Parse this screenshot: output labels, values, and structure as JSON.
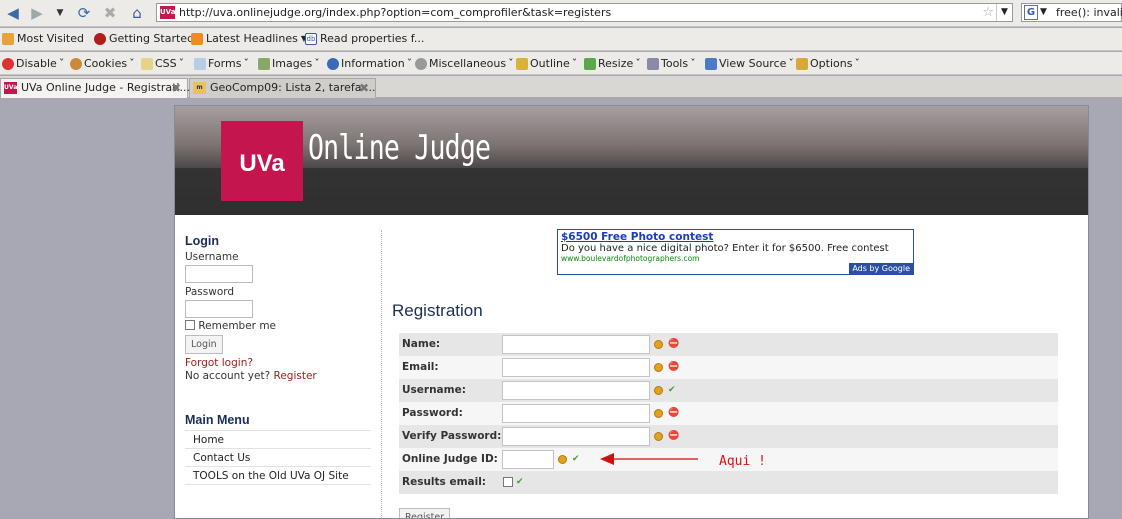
{
  "browser": {
    "url": "http://uva.onlinejudge.org/index.php?option=com_comprofiler&task=registers",
    "search_text": "free(): invalid",
    "bookmarks": [
      "Most Visited",
      "Getting Started",
      "Latest Headlines",
      "Read properties f..."
    ],
    "devtools": [
      "Disable",
      "Cookies",
      "CSS",
      "Forms",
      "Images",
      "Information",
      "Miscellaneous",
      "Outline",
      "Resize",
      "Tools",
      "View Source",
      "Options"
    ],
    "tabs": [
      {
        "title": "UVa Online Judge - Registrati..."
      },
      {
        "title": "GeoComp09: Lista 2, tarefa ..."
      }
    ]
  },
  "header": {
    "logo_text": "UVa",
    "site_title": "Online Judge"
  },
  "login": {
    "heading": "Login",
    "username_label": "Username",
    "password_label": "Password",
    "remember_label": "Remember me",
    "button_label": "Login",
    "forgot_link": "Forgot login?",
    "no_account_text": "No account yet?",
    "register_link": "Register"
  },
  "main_menu": {
    "heading": "Main Menu",
    "items": [
      "Home",
      "Contact Us",
      "TOOLS on the Old UVa OJ Site"
    ]
  },
  "ad": {
    "title": "$6500 Free Photo contest",
    "body": "Do you have a nice digital photo? Enter it for $6500. Free contest",
    "url": "www.boulevardofphotographers.com",
    "badge": "Ads by Google"
  },
  "registration": {
    "heading": "Registration",
    "fields": [
      {
        "label": "Name:"
      },
      {
        "label": "Email:"
      },
      {
        "label": "Username:"
      },
      {
        "label": "Password:"
      },
      {
        "label": "Verify Password:"
      },
      {
        "label": "Online Judge ID:"
      },
      {
        "label": "Results email:"
      }
    ],
    "submit_label": "Register"
  },
  "annotation": {
    "text": "Aqui !",
    "color": "#cc1111"
  },
  "colors": {
    "brand": "#c4154f",
    "heading": "#1b2e5a",
    "link_red": "#9b1b1b"
  }
}
